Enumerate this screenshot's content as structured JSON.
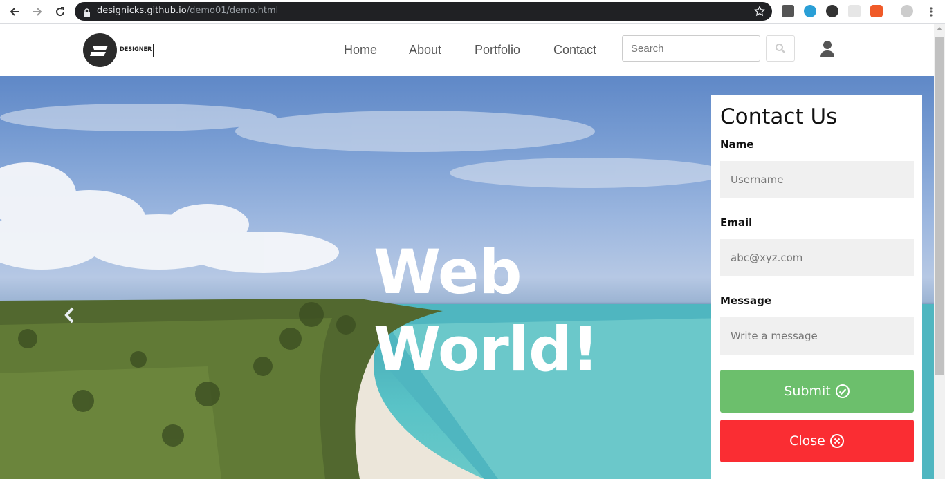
{
  "browser": {
    "url_host": "designicks.github.io",
    "url_path": "/demo01/demo.html"
  },
  "header": {
    "logo_text": "DESIGNER",
    "nav": [
      {
        "label": "Home"
      },
      {
        "label": "About"
      },
      {
        "label": "Portfolio"
      },
      {
        "label": "Contact"
      }
    ],
    "search_placeholder": "Search"
  },
  "hero": {
    "title_line1": "Web",
    "title_line2": "World!"
  },
  "contact": {
    "title": "Contact Us",
    "name_label": "Name",
    "name_placeholder": "Username",
    "email_label": "Email",
    "email_placeholder": "abc@xyz.com",
    "message_label": "Message",
    "message_placeholder": "Write a message",
    "submit_label": "Submit",
    "close_label": "Close"
  },
  "colors": {
    "submit": "#6cbf6c",
    "close": "#fa2d33",
    "omnibox": "#202124"
  }
}
